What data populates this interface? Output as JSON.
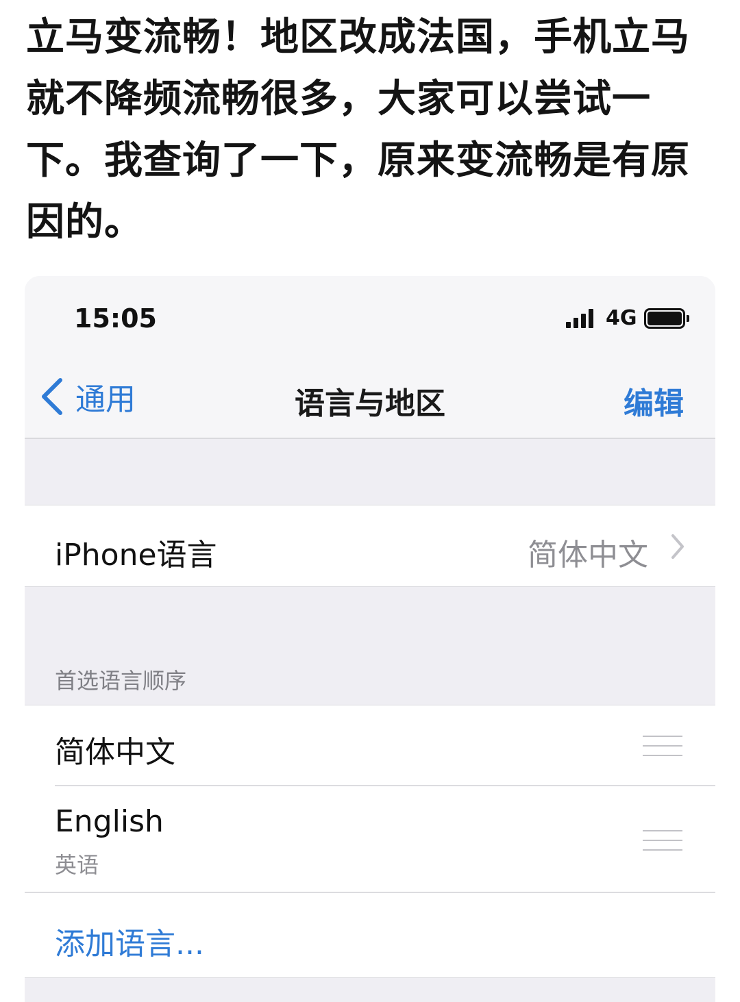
{
  "post": {
    "text": "立马变流畅！地区改成法国，手机立马就不降频流畅很多，大家可以尝试一下。我查询了一下，原来变流畅是有原因的。"
  },
  "status_bar": {
    "time": "15:05",
    "network": "4G",
    "signal_icon": "cellular-signal-icon",
    "battery_icon": "battery-icon"
  },
  "nav": {
    "back_label": "通用",
    "title": "语言与地区",
    "edit_label": "编辑"
  },
  "iphone_language": {
    "label": "iPhone语言",
    "value": "简体中文"
  },
  "preferred_languages": {
    "header": "首选语言顺序",
    "items": [
      {
        "name": "简体中文",
        "subtitle": ""
      },
      {
        "name": "English",
        "subtitle": "英语"
      }
    ],
    "add_label": "添加语言..."
  },
  "colors": {
    "accent": "#2f7bd6",
    "secondary_text": "#8e8e93",
    "grouped_background": "#efeef3"
  }
}
